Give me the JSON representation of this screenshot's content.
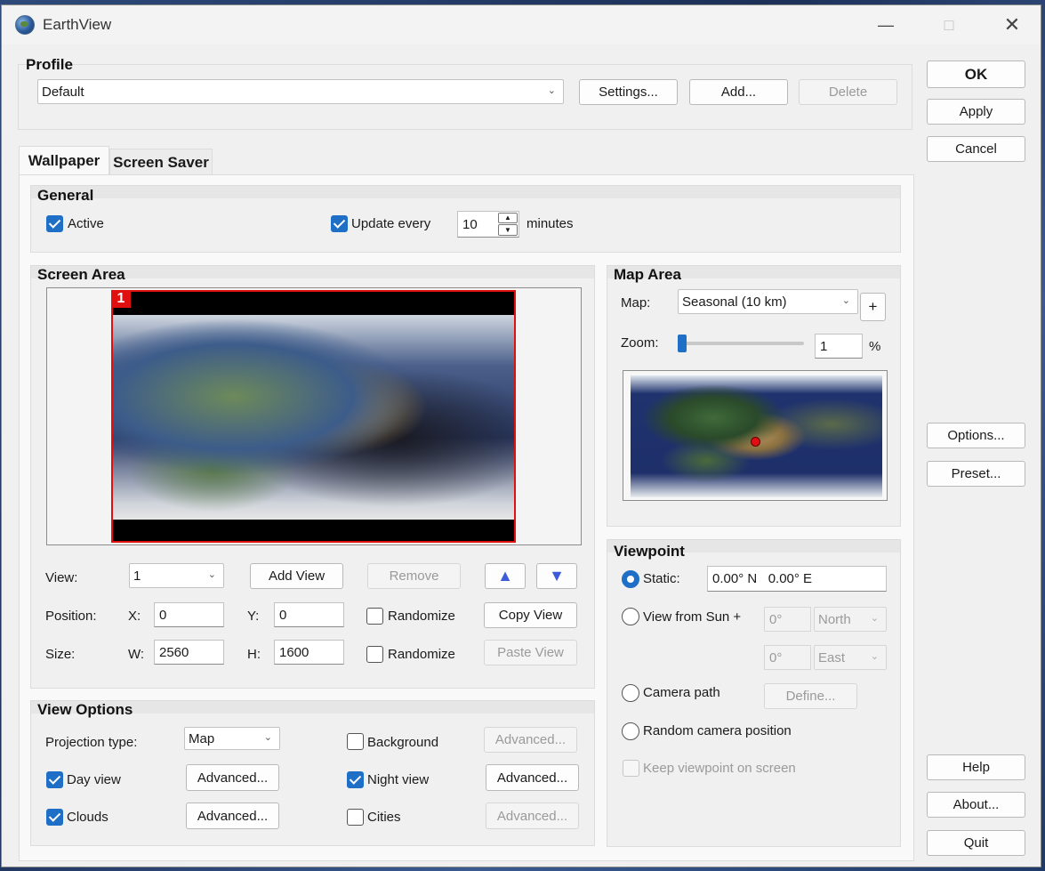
{
  "window": {
    "title": "EarthView"
  },
  "profile": {
    "group_label": "Profile",
    "selected": "Default",
    "settings_label": "Settings...",
    "add_label": "Add...",
    "delete_label": "Delete"
  },
  "side": {
    "ok": "OK",
    "apply": "Apply",
    "cancel": "Cancel",
    "options": "Options...",
    "preset": "Preset...",
    "help": "Help",
    "about": "About...",
    "quit": "Quit"
  },
  "tabs": [
    {
      "label": "Wallpaper",
      "active": true
    },
    {
      "label": "Screen Saver",
      "active": false
    }
  ],
  "general": {
    "label": "General",
    "active_label": "Active",
    "active_checked": true,
    "update_label": "Update every",
    "update_checked": true,
    "update_value": "10",
    "minutes_label": "minutes"
  },
  "screen_area": {
    "label": "Screen Area",
    "screen_badge": "1",
    "view_label": "View:",
    "view_value": "1",
    "add_view": "Add View",
    "remove": "Remove",
    "up_arrow": "▲",
    "down_arrow": "▼",
    "position_label": "Position:",
    "x_label": "X:",
    "x_value": "0",
    "y_label": "Y:",
    "y_value": "0",
    "randomize_label": "Randomize",
    "copy_view": "Copy View",
    "size_label": "Size:",
    "w_label": "W:",
    "w_value": "2560",
    "h_label": "H:",
    "h_value": "1600",
    "paste_view": "Paste View"
  },
  "map_area": {
    "label": "Map Area",
    "map_label": "Map:",
    "map_value": "Seasonal (10 km)",
    "plus": "+",
    "zoom_label": "Zoom:",
    "zoom_value": "1",
    "zoom_unit": "%",
    "zoom_fraction": 0.0
  },
  "viewpoint": {
    "label": "Viewpoint",
    "static_label": "Static:",
    "static_value": "0.00° N   0.00° E",
    "sun_label": "View from Sun +",
    "sun_lat": "0°",
    "sun_lat_dir": "North",
    "sun_lon": "0°",
    "sun_lon_dir": "East",
    "camera_label": "Camera path",
    "define_label": "Define...",
    "random_label": "Random camera position",
    "keep_label": "Keep viewpoint on screen"
  },
  "view_options": {
    "label": "View Options",
    "projection_label": "Projection type:",
    "projection_value": "Map",
    "background_label": "Background",
    "day_label": "Day view",
    "night_label": "Night view",
    "clouds_label": "Clouds",
    "cities_label": "Cities",
    "advanced": "Advanced..."
  },
  "colors": {
    "accent": "#1f6fc7",
    "arrow": "#3d5bd6",
    "marker": "#e01010",
    "screen_border": "#e01010"
  }
}
